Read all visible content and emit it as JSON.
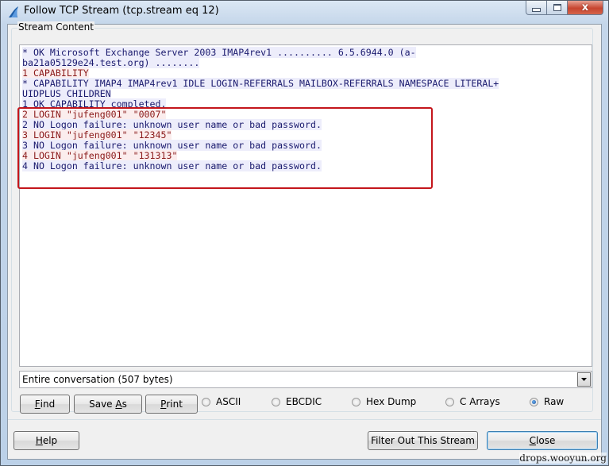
{
  "window": {
    "title": "Follow TCP Stream (tcp.stream eq 12)",
    "icon": "wireshark-fin-icon",
    "controls": {
      "minimize": "minimize",
      "maximize": "maximize",
      "close": "x"
    }
  },
  "stream": {
    "group_label": "Stream Content",
    "lines": [
      {
        "dir": "server",
        "text": "* OK Microsoft Exchange Server 2003 IMAP4rev1 .......... 6.5.6944.0 (a-"
      },
      {
        "dir": "server",
        "text": "ba21a05129e24.test.org) ........"
      },
      {
        "dir": "client",
        "text": "1 CAPABILITY"
      },
      {
        "dir": "server",
        "text": "* CAPABILITY IMAP4 IMAP4rev1 IDLE LOGIN-REFERRALS MAILBOX-REFERRALS NAMESPACE LITERAL+"
      },
      {
        "dir": "server",
        "text": "UIDPLUS CHILDREN"
      },
      {
        "dir": "server",
        "text": "1 OK CAPABILITY completed."
      },
      {
        "dir": "client",
        "text": "2 LOGIN \"jufeng001\" \"0007\""
      },
      {
        "dir": "server",
        "text": "2 NO Logon failure: unknown user name or bad password."
      },
      {
        "dir": "client",
        "text": "3 LOGIN \"jufeng001\" \"12345\""
      },
      {
        "dir": "server",
        "text": "3 NO Logon failure: unknown user name or bad password."
      },
      {
        "dir": "client",
        "text": "4 LOGIN \"jufeng001\" \"131313\""
      },
      {
        "dir": "server",
        "text": "4 NO Logon failure: unknown user name or bad password."
      }
    ],
    "colors": {
      "client_text": "#8b1a1a",
      "client_bg": "#fbeded",
      "server_text": "#1a1a6e",
      "server_bg": "#ededfb",
      "annotation_box": "#c4161c"
    }
  },
  "conversation_select": {
    "value": "Entire conversation (507 bytes)"
  },
  "buttons": {
    "find": {
      "pre": "",
      "ul": "F",
      "post": "ind"
    },
    "save_as": {
      "pre": "Save ",
      "ul": "A",
      "post": "s"
    },
    "print": {
      "pre": "",
      "ul": "P",
      "post": "rint"
    },
    "help": {
      "pre": "",
      "ul": "H",
      "post": "elp"
    },
    "filter_out": "Filter Out This Stream",
    "close": {
      "pre": "",
      "ul": "C",
      "post": "lose"
    }
  },
  "formats": {
    "options": [
      "ASCII",
      "EBCDIC",
      "Hex Dump",
      "C Arrays",
      "Raw"
    ],
    "selected": "Raw"
  },
  "watermark": "drops.wooyun.org"
}
